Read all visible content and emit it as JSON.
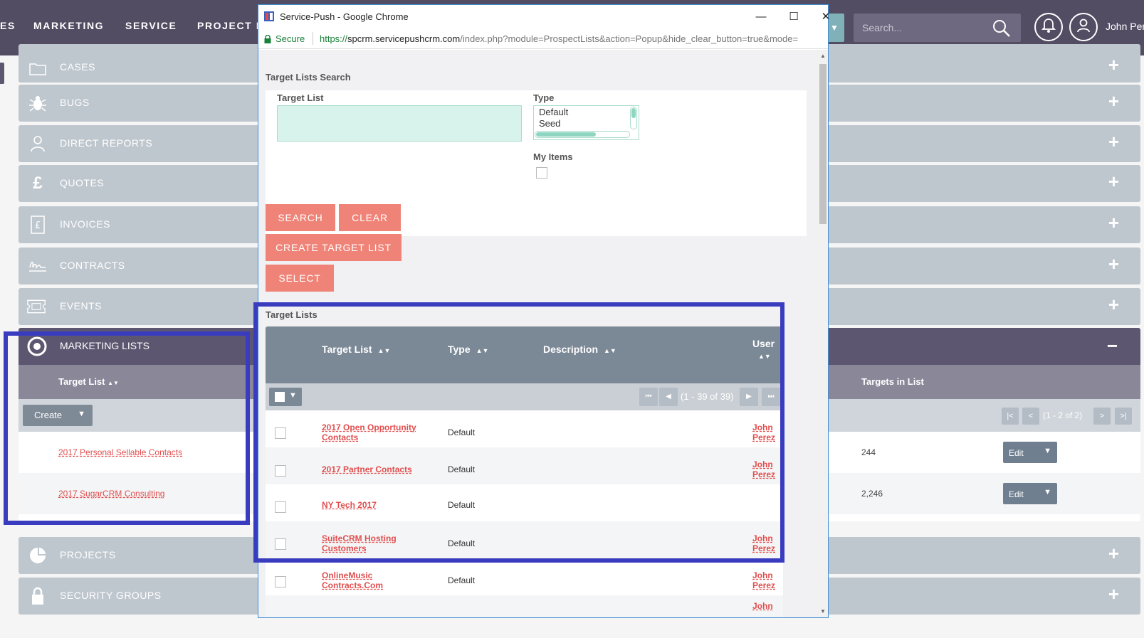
{
  "topnav": {
    "items": [
      "ES",
      "MARKETING",
      "SERVICE",
      "PROJECT M"
    ],
    "search_placeholder": "Search...",
    "username": "John Perez"
  },
  "sidebar": {
    "items": [
      {
        "label": "CASES",
        "icon": "folder-icon"
      },
      {
        "label": "BUGS",
        "icon": "bug-icon"
      },
      {
        "label": "DIRECT REPORTS",
        "icon": "person-icon"
      },
      {
        "label": "QUOTES",
        "icon": "pound-icon"
      },
      {
        "label": "INVOICES",
        "icon": "invoice-icon"
      },
      {
        "label": "CONTRACTS",
        "icon": "signature-icon"
      },
      {
        "label": "EVENTS",
        "icon": "ticket-icon"
      }
    ],
    "bottom_items": [
      {
        "label": "PROJECTS",
        "icon": "pie-icon"
      },
      {
        "label": "SECURITY GROUPS",
        "icon": "lock-icon"
      }
    ],
    "plus": "+"
  },
  "marketing_lists": {
    "title": "MARKETING LISTS",
    "collapse": "−",
    "col_target_list": "Target List",
    "col_targets": "Targets in List",
    "sort": "▲▼",
    "create_label": "Create",
    "pager_text": "(1 - 2 of 2)",
    "rows": [
      {
        "name": "2017 Personal Sellable Contacts",
        "count": "244",
        "edit": "Edit"
      },
      {
        "name": "2017 SugarCRM Consulting",
        "count": "2,246",
        "edit": "Edit"
      }
    ]
  },
  "popup": {
    "window_title": "Service-Push - Google Chrome",
    "secure_label": "Secure",
    "url_scheme": "https://",
    "url_host": "spcrm.servicepushcrm.com",
    "url_rest": "/index.php?module=ProspectLists&action=Popup&hide_clear_button=true&mode=",
    "search_title": "Target Lists Search",
    "field_target_list": "Target List",
    "field_type": "Type",
    "type_options": [
      "Default",
      "Seed"
    ],
    "field_my_items": "My Items",
    "btn_search": "SEARCH",
    "btn_clear": "CLEAR",
    "btn_create": "CREATE TARGET LIST",
    "btn_select": "SELECT",
    "results_title": "Target Lists",
    "col_target_list": "Target List",
    "col_type": "Type",
    "col_description": "Description",
    "col_user": "User",
    "sort": "▲▼",
    "pager_text": "(1 - 39 of 39)",
    "rows": [
      {
        "name_line1": "2017 Open Opportunity",
        "name_line2": "Contacts",
        "type": "Default",
        "user1": "John",
        "user2": "Perez"
      },
      {
        "name_line1": "2017 Partner Contacts",
        "name_line2": "",
        "type": "Default",
        "user1": "John",
        "user2": "Perez"
      },
      {
        "name_line1": "NY Tech 2017",
        "name_line2": "",
        "type": "Default",
        "user1": "",
        "user2": ""
      },
      {
        "name_line1": "SuiteCRM Hosting",
        "name_line2": "Customers",
        "type": "Default",
        "user1": "John",
        "user2": "Perez"
      },
      {
        "name_line1": "OnlineMusic",
        "name_line2": "Contracts.Com",
        "type": "Default",
        "user1": "John",
        "user2": "Perez"
      }
    ],
    "partial_user": "John"
  },
  "colors": {
    "nav_bg": "#534d64",
    "accent_salmon": "#f08377",
    "link_red": "#e14e4e",
    "highlight_blue": "#3a3cbf"
  }
}
